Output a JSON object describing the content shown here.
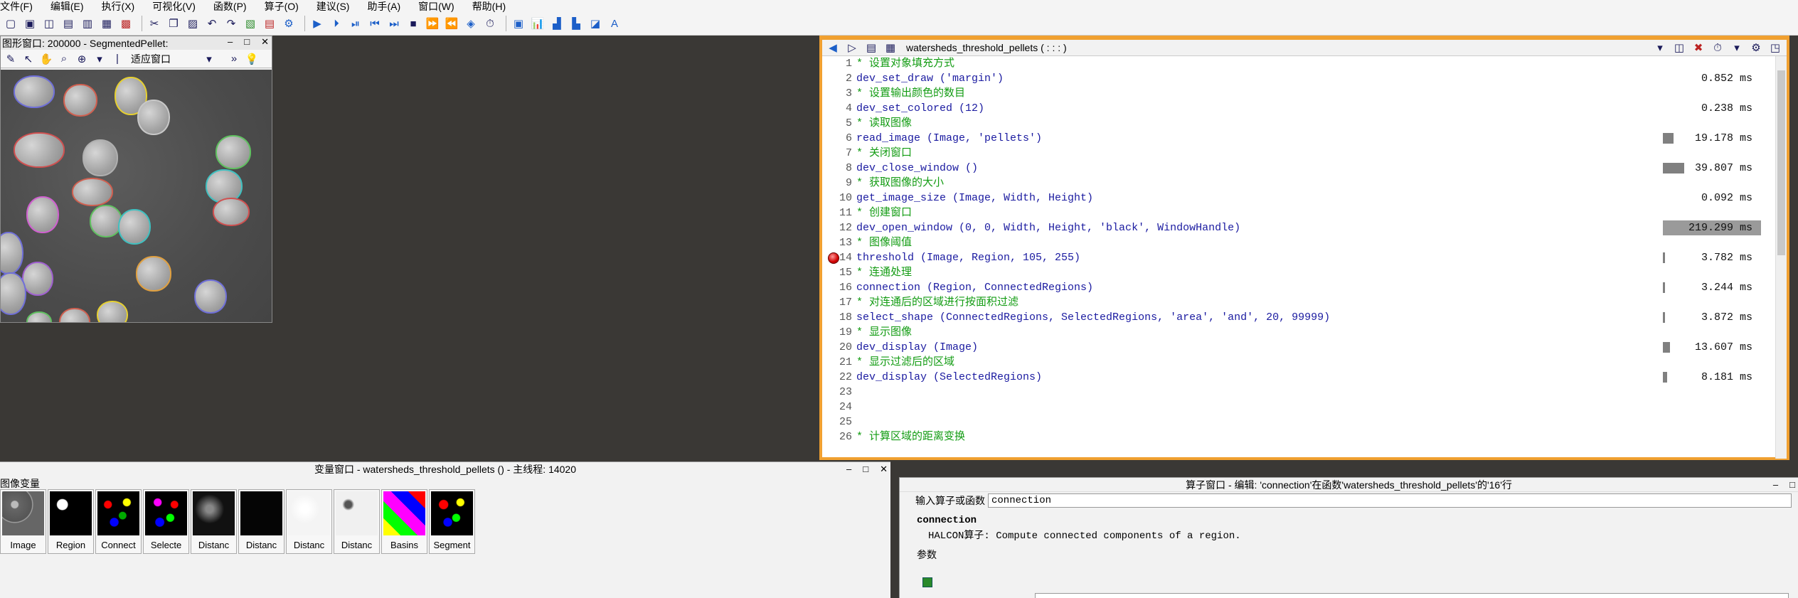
{
  "menu": [
    "文件(F)",
    "编辑(E)",
    "执行(X)",
    "可视化(V)",
    "函数(P)",
    "算子(O)",
    "建议(S)",
    "助手(A)",
    "窗口(W)",
    "帮助(H)"
  ],
  "graphics_window": {
    "title": "图形窗口: 200000 - SegmentedPellet:",
    "zoom_label": "适应窗口"
  },
  "program_window": {
    "procedure": "watersheds_threshold_pellets ( : : : )",
    "lines": [
      {
        "n": "1",
        "type": "comment",
        "text": "* 设置对象填充方式",
        "time": ""
      },
      {
        "n": "2",
        "type": "code",
        "text": "dev_set_draw ('margin')",
        "time": "0.852 ms"
      },
      {
        "n": "3",
        "type": "comment",
        "text": "* 设置输出颜色的数目",
        "time": ""
      },
      {
        "n": "4",
        "type": "code",
        "text": "dev_set_colored (12)",
        "time": "0.238 ms"
      },
      {
        "n": "5",
        "type": "comment",
        "text": "*  读取图像",
        "time": ""
      },
      {
        "n": "6",
        "type": "code",
        "text": "read_image (Image, 'pellets')",
        "time": "19.178 ms"
      },
      {
        "n": "7",
        "type": "comment",
        "text": "*  关闭窗口",
        "time": ""
      },
      {
        "n": "8",
        "type": "code",
        "text": "dev_close_window ()",
        "time": "39.807 ms"
      },
      {
        "n": "9",
        "type": "comment",
        "text": "*  获取图像的大小",
        "time": ""
      },
      {
        "n": "10",
        "type": "code",
        "text": "get_image_size (Image, Width, Height)",
        "time": "0.092 ms"
      },
      {
        "n": "11",
        "type": "comment",
        "text": "*  创建窗口",
        "time": ""
      },
      {
        "n": "12",
        "type": "code",
        "text": "dev_open_window (0, 0, Width, Height, 'black', WindowHandle)",
        "time": "219.299 ms"
      },
      {
        "n": "13",
        "type": "comment",
        "text": "*  图像阈值",
        "time": ""
      },
      {
        "n": "14",
        "type": "code",
        "text": "threshold (Image, Region, 105, 255)",
        "time": "3.782 ms"
      },
      {
        "n": "15",
        "type": "comment",
        "text": "*  连通处理",
        "time": ""
      },
      {
        "n": "16",
        "type": "code",
        "text": "connection (Region, ConnectedRegions)",
        "time": "3.244 ms"
      },
      {
        "n": "17",
        "type": "comment",
        "text": "*  对连通后的区域进行按面积过滤",
        "time": ""
      },
      {
        "n": "18",
        "type": "code",
        "text": "select_shape (ConnectedRegions, SelectedRegions, 'area', 'and', 20, 99999)",
        "time": "3.872 ms"
      },
      {
        "n": "19",
        "type": "comment",
        "text": "* 显示图像",
        "time": ""
      },
      {
        "n": "20",
        "type": "code",
        "text": "dev_display (Image)",
        "time": "13.607 ms"
      },
      {
        "n": "21",
        "type": "comment",
        "text": "* 显示过滤后的区域",
        "time": ""
      },
      {
        "n": "22",
        "type": "code",
        "text": "dev_display (SelectedRegions)",
        "time": "8.181 ms"
      },
      {
        "n": "23",
        "type": "code",
        "text": "",
        "time": ""
      },
      {
        "n": "24",
        "type": "code",
        "text": "",
        "time": ""
      },
      {
        "n": "25",
        "type": "code",
        "text": "",
        "time": ""
      },
      {
        "n": "26",
        "type": "comment",
        "text": "* 计算区域的距离变换",
        "time": ""
      }
    ]
  },
  "variable_window": {
    "title": "变量窗口 - watersheds_threshold_pellets () - 主线程: 14020",
    "section_label": "图像变量",
    "items": [
      "Image",
      "Region",
      "Connect",
      "Selecte",
      "Distanc",
      "Distanc",
      "Distanc",
      "Distanc",
      "Basins",
      "Segment"
    ]
  },
  "operator_window": {
    "title": "算子窗口 - 编辑: 'connection'在函数'watersheds_threshold_pellets'的'16'行",
    "input_label": "输入算子或函数",
    "input_value": "connection",
    "op_name": "connection",
    "op_desc": "HALCON算子: Compute connected components of a region.",
    "params_label": "参数"
  },
  "colors": {
    "active_border": "#f0a030",
    "comment": "#139c13",
    "code": "#1a1aa0"
  }
}
